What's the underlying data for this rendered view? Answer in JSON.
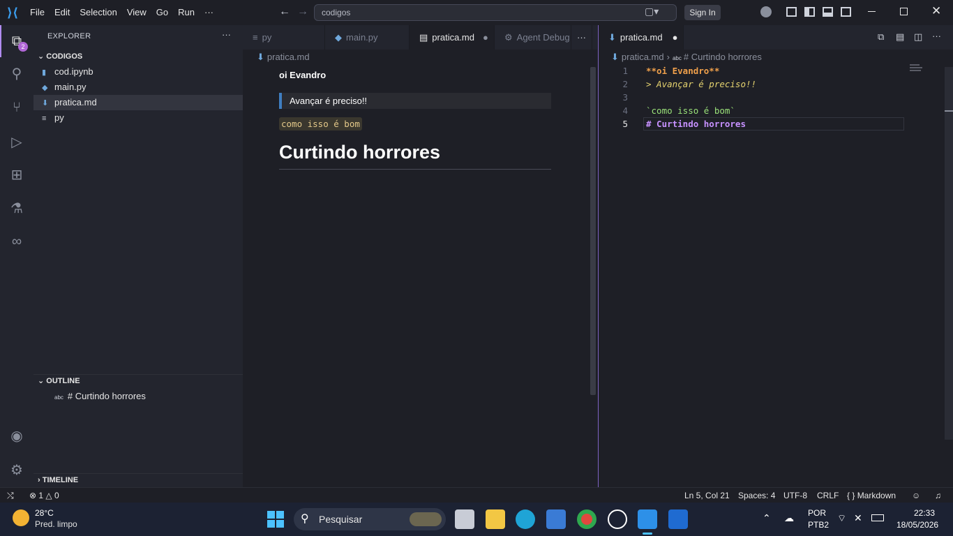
{
  "titlebar": {
    "menu": [
      "File",
      "Edit",
      "Selection",
      "View",
      "Go",
      "Run",
      "···"
    ],
    "search": "codigos",
    "signin": "Sign In"
  },
  "activity": {
    "badge": "2"
  },
  "explorer": {
    "header": "EXPLORER",
    "more": "···",
    "folder": "CODIGOS",
    "files": [
      "cod.ipynb",
      "main.py",
      "pratica.md",
      "py"
    ],
    "outline_title": "OUTLINE",
    "outline_item": "# Curtindo horrores",
    "outline_abc": "abc",
    "timeline_title": "TIMELINE"
  },
  "group1": {
    "tabs": [
      "py",
      "main.py",
      "pratica.md",
      "Agent Debug"
    ],
    "more": "···",
    "breadcrumb": "pratica.md",
    "preview": {
      "bold": "oi Evandro",
      "quote": "Avançar é preciso!!",
      "code": "como isso é bom",
      "h1": "Curtindo horrores"
    }
  },
  "group2": {
    "tab": "pratica.md",
    "breadcrumb_file": "pratica.md",
    "breadcrumb_symbol": "# Curtindo horrores",
    "breadcrumb_abc": "abc",
    "lines": [
      {
        "n": "1",
        "text": "**oi Evandro**"
      },
      {
        "n": "2",
        "text": "> Avançar é preciso!!"
      },
      {
        "n": "3",
        "text": ""
      },
      {
        "n": "4",
        "text": "`como isso é bom`"
      },
      {
        "n": "5",
        "text": "# Curtindo horrores"
      }
    ]
  },
  "status": {
    "errors": "1",
    "warnings": "0",
    "position": "Ln 5, Col 21",
    "spaces": "Spaces: 4",
    "encoding": "UTF-8",
    "eol": "CRLF",
    "language": "Markdown"
  },
  "taskbar": {
    "temp": "28°C",
    "weather": "Pred. limpo",
    "search": "Pesquisar",
    "lang1": "POR",
    "lang2": "PTB2",
    "time": "22:33",
    "date": "18/05/2026"
  },
  "colors": {
    "accent": "#7e64c4",
    "bold_md": "#f0a04b",
    "quote_md": "#e6d36f",
    "code_md": "#9be37a",
    "heading_md": "#c791ff"
  }
}
